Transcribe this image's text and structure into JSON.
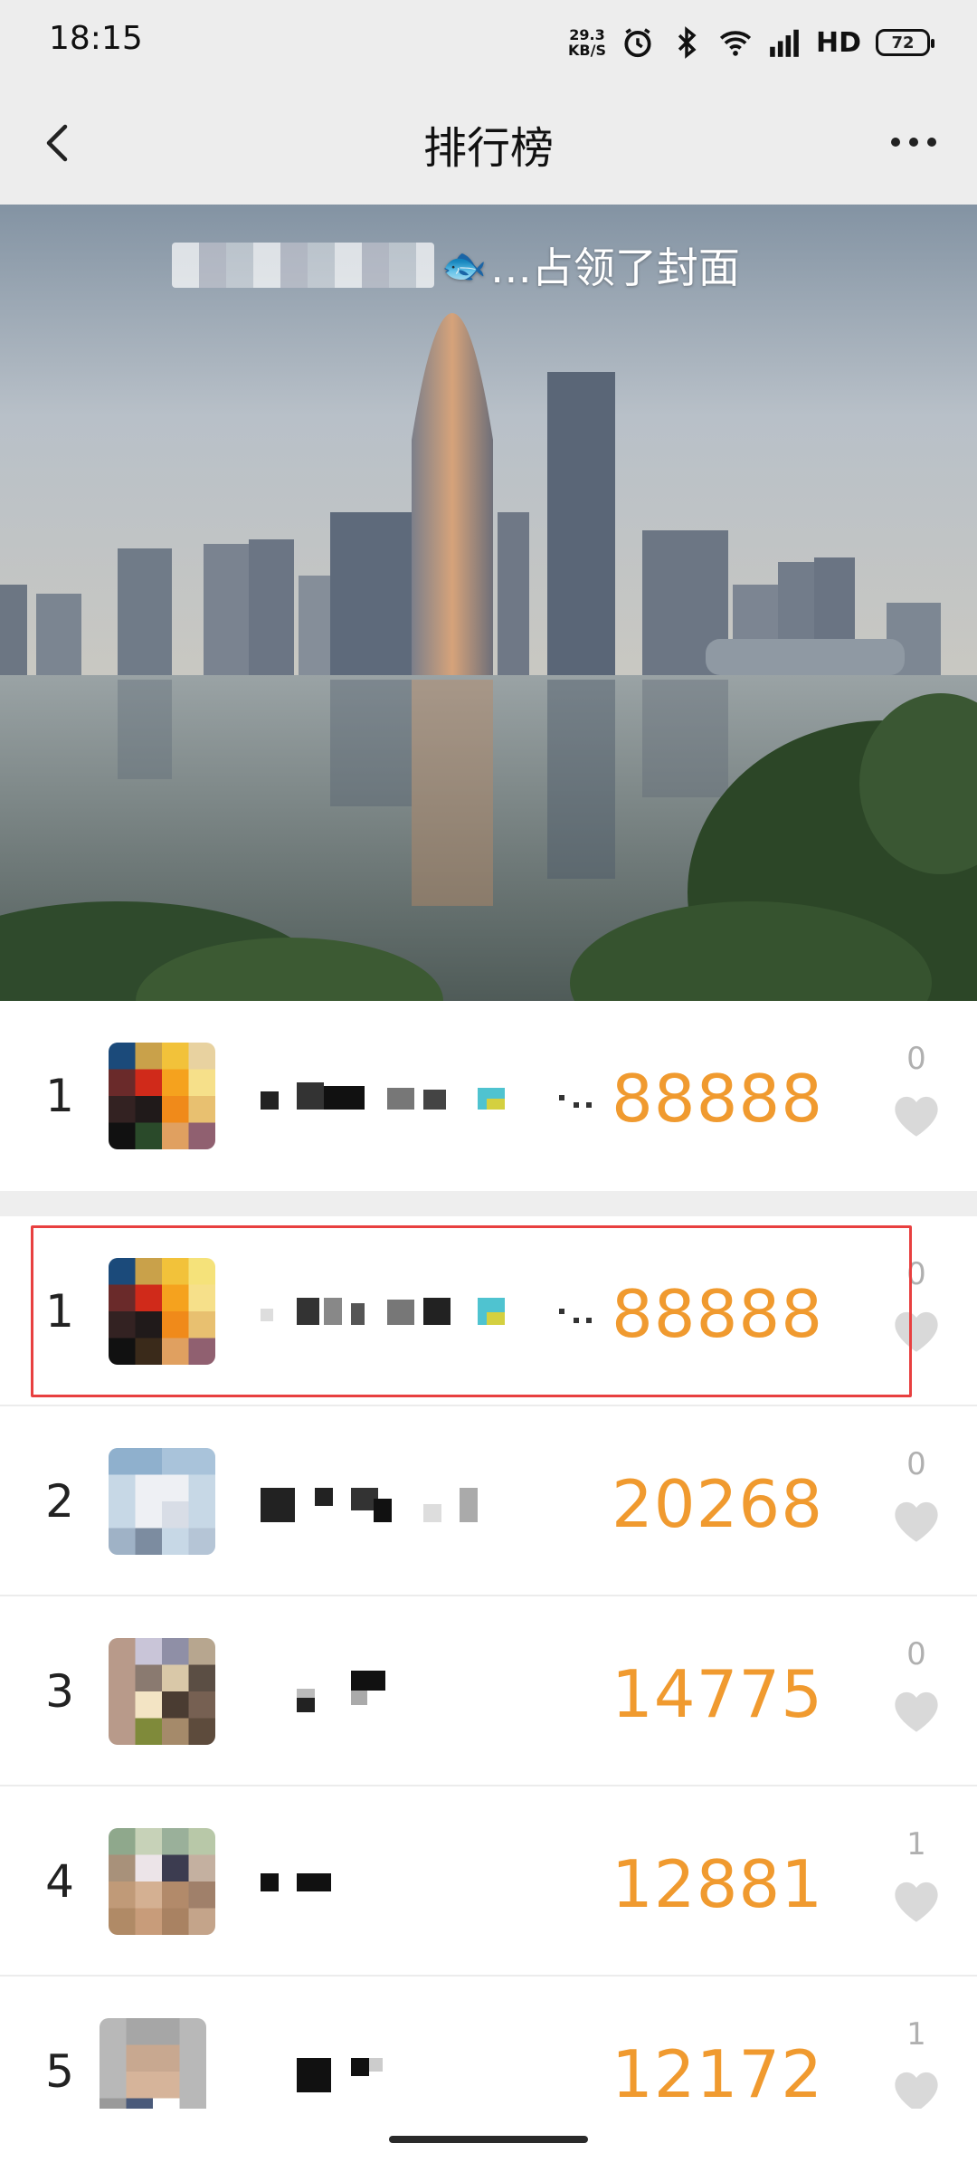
{
  "status_bar": {
    "time": "18:15",
    "net_speed_value": "29.3",
    "net_speed_unit": "KB/S",
    "hd": "HD",
    "battery": "72"
  },
  "nav": {
    "title": "排行榜"
  },
  "cover": {
    "caption": "…占领了封面"
  },
  "colors": {
    "score": "#f09a2f",
    "highlight_border": "#e84040",
    "bar_bg": "#ededed"
  },
  "my_rank": {
    "rank": "1",
    "score": "88888",
    "likes": "0"
  },
  "ranking": [
    {
      "rank": "1",
      "score": "88888",
      "likes": "0"
    },
    {
      "rank": "2",
      "score": "20268",
      "likes": "0"
    },
    {
      "rank": "3",
      "score": "14775",
      "likes": "0"
    },
    {
      "rank": "4",
      "score": "12881",
      "likes": "1"
    },
    {
      "rank": "5",
      "score": "12172",
      "likes": "1"
    }
  ]
}
